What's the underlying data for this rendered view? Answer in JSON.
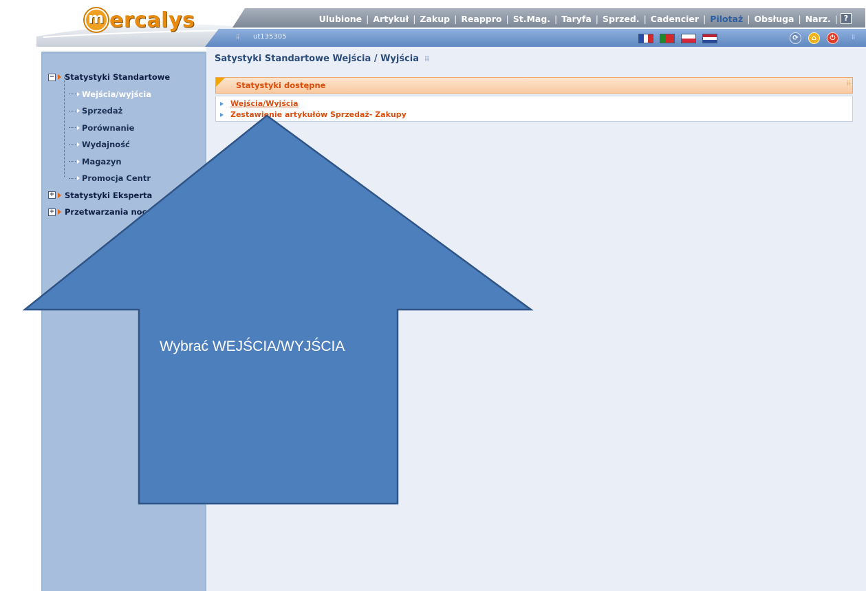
{
  "brand": {
    "logo_text": "ercalys",
    "logo_badge": "m"
  },
  "topmenu": {
    "items": [
      {
        "label": "Ulubione",
        "active": false
      },
      {
        "label": "Artykuł",
        "active": false
      },
      {
        "label": "Zakup",
        "active": false
      },
      {
        "label": "Reappro",
        "active": false
      },
      {
        "label": "St.Mag.",
        "active": false
      },
      {
        "label": "Taryfa",
        "active": false
      },
      {
        "label": "Sprzed.",
        "active": false
      },
      {
        "label": "Cadencier",
        "active": false
      },
      {
        "label": "Pilotaż",
        "active": true
      },
      {
        "label": "Obsługa",
        "active": false
      },
      {
        "label": "Narz.",
        "active": false
      }
    ],
    "help_label": "?"
  },
  "subbar": {
    "user_code": "ut135305",
    "flags": [
      "fr-flag-icon",
      "pt-flag-icon",
      "pl-flag-icon",
      "nl-flag-icon"
    ],
    "icons": [
      "refresh-icon",
      "home-icon",
      "power-icon"
    ]
  },
  "sidebar": {
    "groups": [
      {
        "label": "Statystyki Standartowe",
        "expanded": true,
        "children": [
          {
            "label": "Wejścia/wyjścia",
            "selected": true
          },
          {
            "label": "Sprzedaż",
            "selected": false
          },
          {
            "label": "Porównanie",
            "selected": false
          },
          {
            "label": "Wydajność",
            "selected": false
          },
          {
            "label": "Magazyn",
            "selected": false
          },
          {
            "label": "Promocja Centr",
            "selected": false
          }
        ]
      },
      {
        "label": "Statystyki Eksperta",
        "expanded": false
      },
      {
        "label": "Przetwarzania noc",
        "expanded": false
      }
    ]
  },
  "main": {
    "title": "Satystyki Standartowe Wejścia / Wyjścia",
    "panel_title": "Statystyki dostępne",
    "links": [
      {
        "label": "Wejścia/Wyjścia"
      },
      {
        "label": "Zestawienie artykułów Sprzedaż- Zakupy"
      }
    ]
  },
  "callout": {
    "text": "Wybrać WEJŚCIA/WYJŚCIA"
  },
  "colors": {
    "menu_gray": "#8c96a3",
    "bar_blue": "#6f93c7",
    "sidebar_blue": "#a7bedc",
    "content_bg": "#e9eef7",
    "accent_orange": "#d94e0c",
    "arrow_fill": "#4e7fbd",
    "arrow_stroke": "#2f5486"
  }
}
